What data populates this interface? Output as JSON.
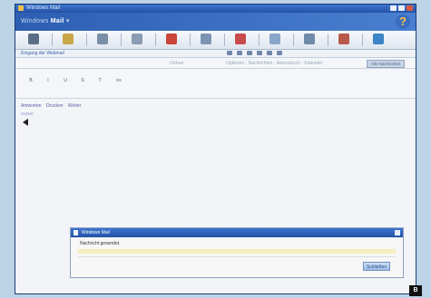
{
  "window": {
    "title": "Windows Mail"
  },
  "brand": {
    "prefix": "Windows ",
    "bold": "Mail",
    "suffix": " ▾"
  },
  "help": {
    "label": "?"
  },
  "toolbar": {
    "buttons": [
      {
        "icon": "globe-icon",
        "color": "#5a6f87"
      },
      {
        "icon": "document-icon",
        "color": "#c9a648"
      },
      {
        "icon": "folder-icon",
        "color": "#7a8ea8"
      },
      {
        "icon": "monitor-icon",
        "color": "#8a9bb3"
      },
      {
        "icon": "red-tool-icon",
        "color": "#c9443a"
      },
      {
        "icon": "compose-icon",
        "color": "#7c93b2"
      },
      {
        "icon": "euro-icon",
        "color": "#c84a4a"
      },
      {
        "icon": "gear-icon",
        "color": "#8aa6c8"
      },
      {
        "icon": "chart-icon",
        "color": "#6f8aa8"
      },
      {
        "icon": "bookmark-icon",
        "color": "#b85a4a"
      },
      {
        "icon": "network-icon",
        "color": "#3d85c8"
      }
    ]
  },
  "address": {
    "text": "Eingang der Webmail"
  },
  "options": {
    "items": [
      "Ordner",
      "Optionen · Nachrichten · Adressbuch · Kalender"
    ],
    "button": "Alle Nachrichten"
  },
  "format": {
    "buttons": [
      "B",
      "I",
      "U",
      "S",
      "T",
      "≡≡"
    ]
  },
  "body": {
    "links": [
      "Antworten",
      "Drucken",
      "Weiter"
    ],
    "sub": "Ordner"
  },
  "dialog": {
    "title": "Windows Mail",
    "message": "Nachricht gesendet.",
    "ok": "Schließen"
  },
  "badge": "B"
}
